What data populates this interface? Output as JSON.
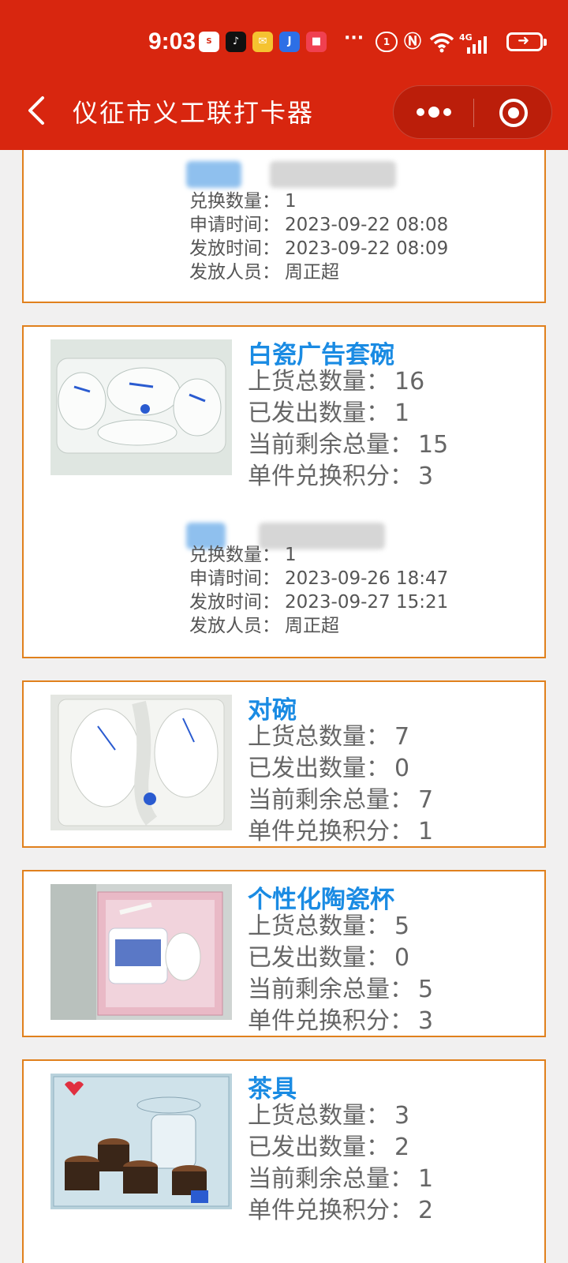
{
  "status_bar": {
    "time": "9:03",
    "network": "4G",
    "apps": [
      "ssp-app-icon",
      "tiktok-icon",
      "mail-icon",
      "jd-app-icon",
      "red-app-icon"
    ],
    "more": "···"
  },
  "nav": {
    "title": "仪征市义工联打卡器"
  },
  "labels": {
    "total": "上货总数量：",
    "issued": "已发出数量：",
    "remaining": "当前剩余总量：",
    "points": "单件兑换积分：",
    "exchange_qty": "兑换数量：",
    "apply_time": "申请时间：",
    "issue_time": "发放时间：",
    "issuer": "发放人员："
  },
  "partial_record": {
    "exchange_qty": "1",
    "apply_time": "2023-09-22 08:08",
    "issue_time": "2023-09-22 08:09",
    "issuer": "周正超"
  },
  "items": [
    {
      "name": "白瓷广告套碗",
      "total": "16",
      "issued": "1",
      "remaining": "15",
      "points": "3",
      "record": {
        "exchange_qty": "1",
        "apply_time": "2023-09-26 18:47",
        "issue_time": "2023-09-27 15:21",
        "issuer": "周正超"
      }
    },
    {
      "name": "对碗",
      "total": "7",
      "issued": "0",
      "remaining": "7",
      "points": "1"
    },
    {
      "name": "个性化陶瓷杯",
      "total": "5",
      "issued": "0",
      "remaining": "5",
      "points": "3"
    },
    {
      "name": "茶具",
      "total": "3",
      "issued": "2",
      "remaining": "1",
      "points": "2"
    }
  ],
  "colors": {
    "header": "#d8260f",
    "card_border": "#e0801d",
    "item_name": "#1a8be3",
    "background": "#f1f0f0"
  }
}
